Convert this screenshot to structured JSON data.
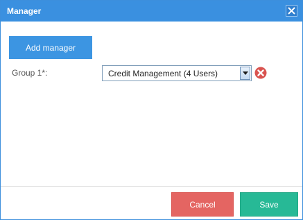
{
  "window": {
    "title": "Manager",
    "close_icon": "close-icon",
    "accent_color": "#3a90e0"
  },
  "main": {
    "add_manager_label": "Add manager",
    "group": {
      "label": "Group 1*:",
      "selected_value": "Credit Management (4 Users)",
      "dropdown_icon": "chevron-down-icon",
      "remove_icon": "remove-circle-icon",
      "remove_color": "#d9534f"
    }
  },
  "footer": {
    "cancel_label": "Cancel",
    "save_label": "Save",
    "cancel_color": "#e46562",
    "save_color": "#27b996"
  }
}
